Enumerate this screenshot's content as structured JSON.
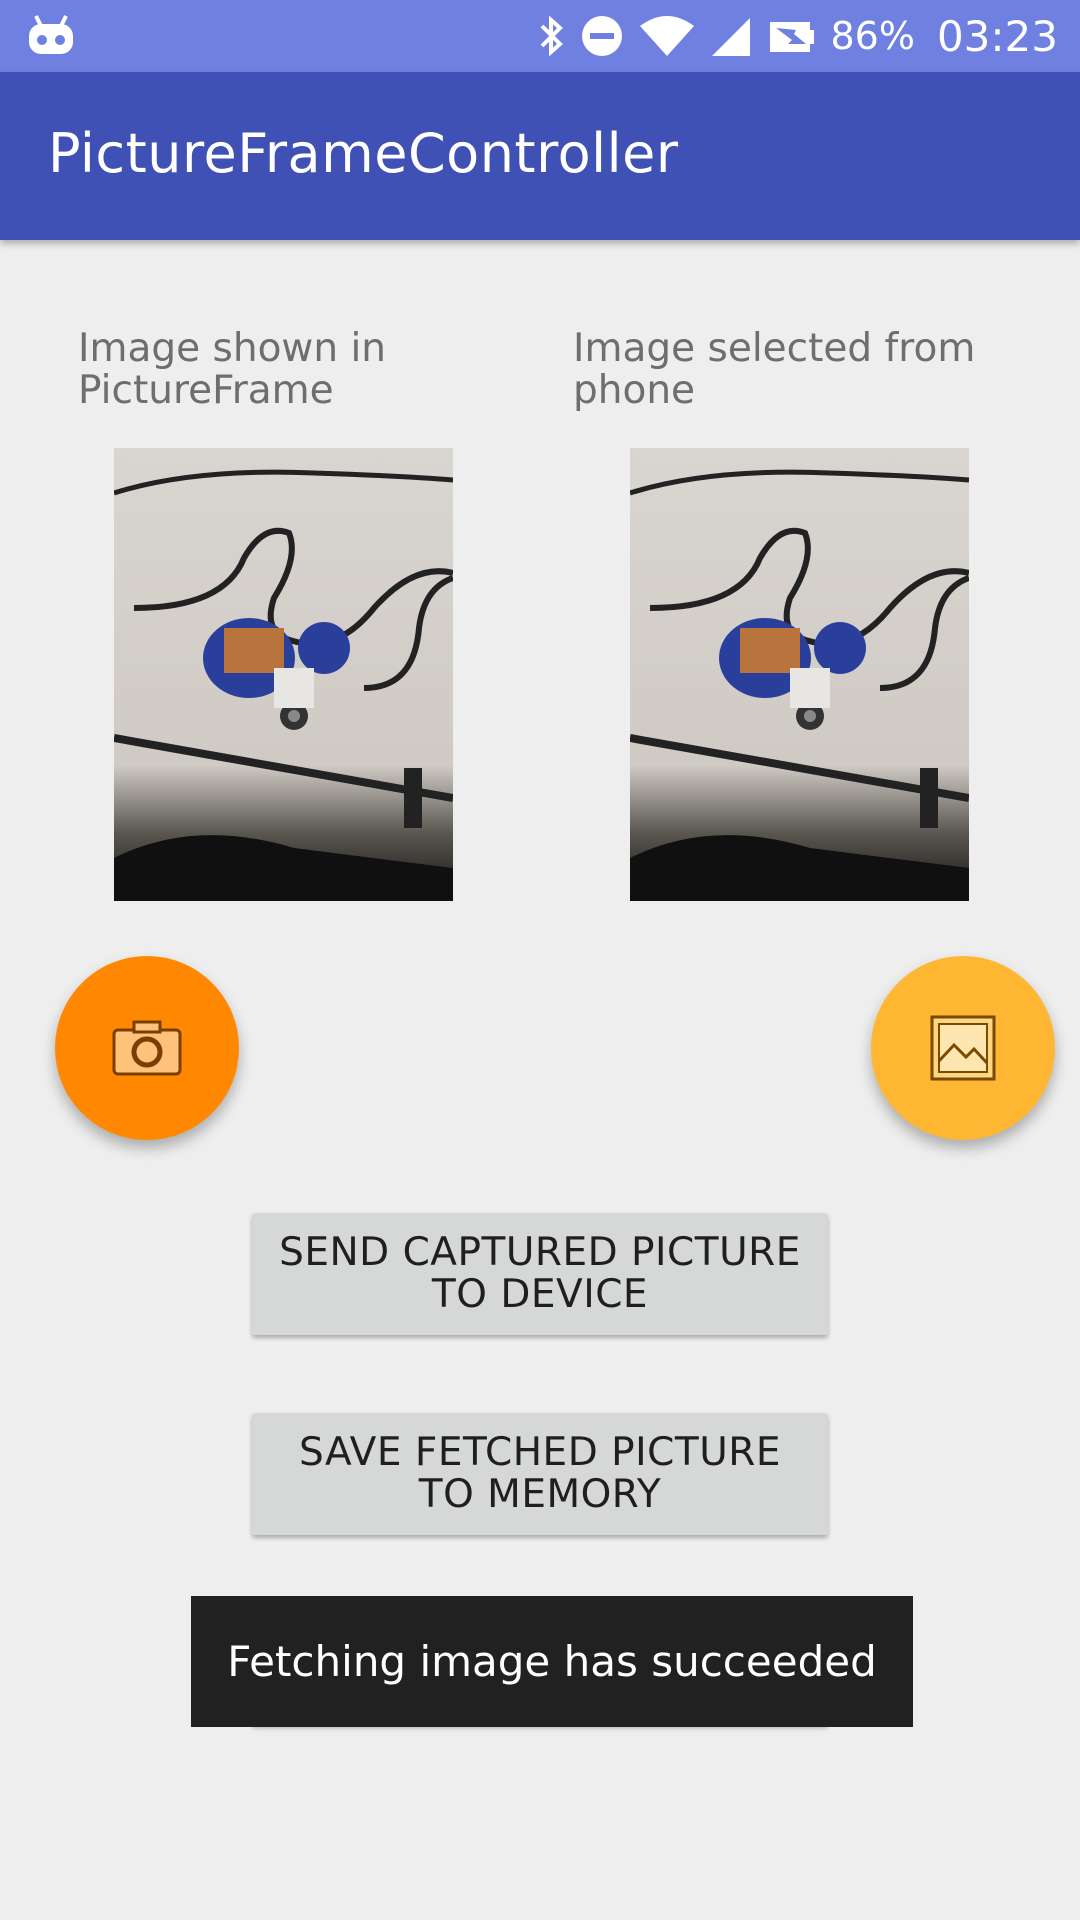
{
  "status_bar": {
    "battery": "86%",
    "time": "03:23",
    "icons": [
      "android-icon",
      "bluetooth-icon",
      "do-not-disturb-icon",
      "wifi-icon",
      "signal-icon",
      "no-sim-icon"
    ]
  },
  "app_bar": {
    "title": "PictureFrameController"
  },
  "captions": {
    "left": "Image shown in PictureFrame",
    "right": "Image selected from phone"
  },
  "fabs": {
    "camera_icon": "camera-icon",
    "gallery_icon": "image-icon",
    "camera_color": "#ff8800",
    "gallery_color": "#ffb733"
  },
  "buttons": {
    "send": "SEND CAPTURED PICTURE TO DEVICE",
    "save": "SAVE FETCHED PICTURE TO MEMORY"
  },
  "toast": {
    "message": "Fetching image has succeeded"
  },
  "colors": {
    "status_bar": "#6f80e0",
    "app_bar": "#3f51b5",
    "background": "#eeeeee",
    "button": "#d6d7d7",
    "toast": "#212121"
  }
}
